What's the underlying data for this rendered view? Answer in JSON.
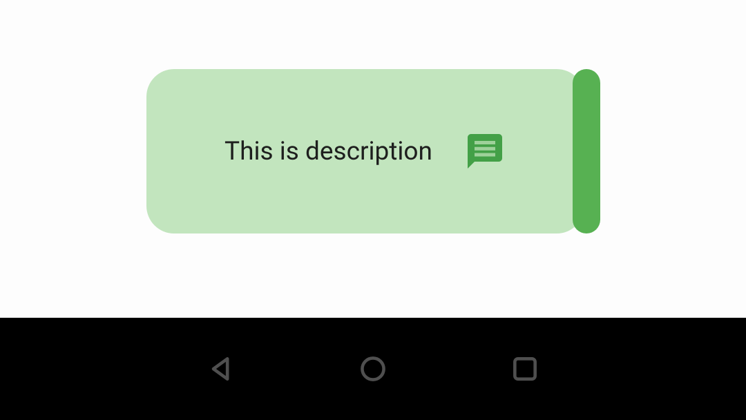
{
  "card": {
    "description": "This is description"
  },
  "colors": {
    "card_bg": "#c2e5be",
    "accent": "#57b152",
    "icon_green": "#43a047",
    "nav_bg": "#000000",
    "nav_icon": "#4f4f4f"
  }
}
